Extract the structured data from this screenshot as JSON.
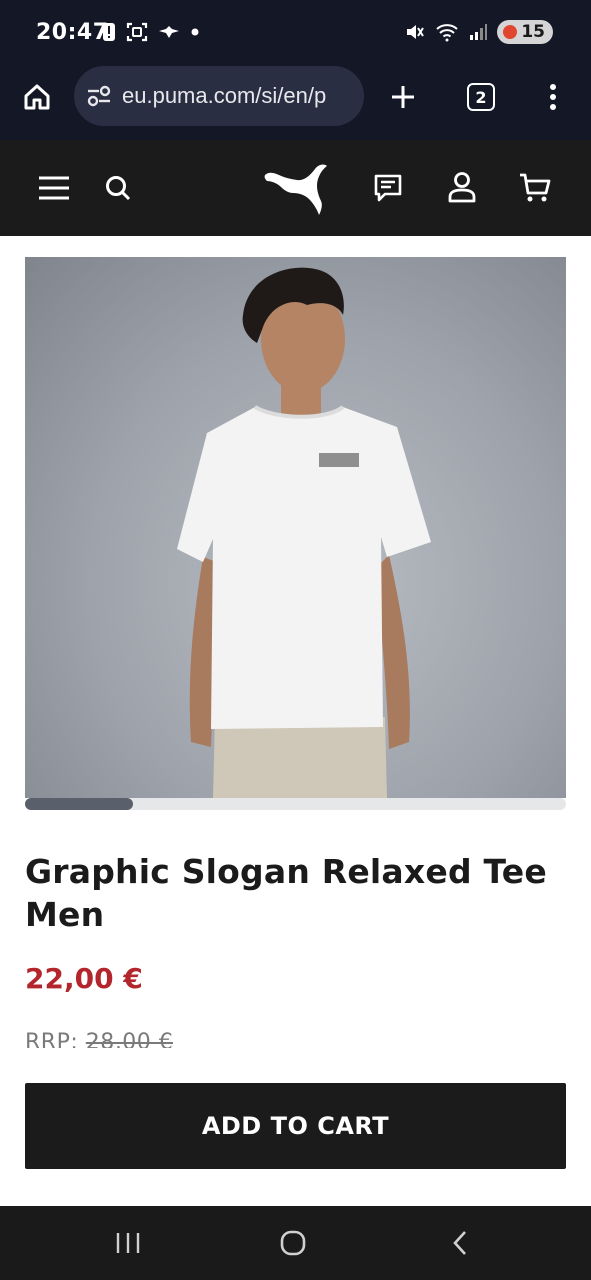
{
  "status_bar": {
    "time": "20:47",
    "battery": "15",
    "icons": [
      "alert-icon",
      "screenshot-icon",
      "bird-icon",
      "dot-icon",
      "mute-icon",
      "wifi-icon",
      "signal-icon",
      "battery-icon"
    ]
  },
  "browser": {
    "url": "eu.puma.com/si/en/p",
    "tab_count": "2"
  },
  "header": {
    "brand": "puma-logo"
  },
  "product": {
    "image_alt": "Man wearing white relaxed tee",
    "carousel_progress": 0.2,
    "title": "Graphic Slogan Relaxed Tee Men",
    "price": "22,00 €",
    "rrp_label": "RRP:",
    "rrp_value": "28,00 €"
  },
  "actions": {
    "add_to_cart": "ADD TO CART"
  },
  "colors": {
    "header_bg": "#1b1b1b",
    "status_bg": "#141726",
    "price": "#b2262c",
    "button_bg": "#1b1b1b"
  }
}
